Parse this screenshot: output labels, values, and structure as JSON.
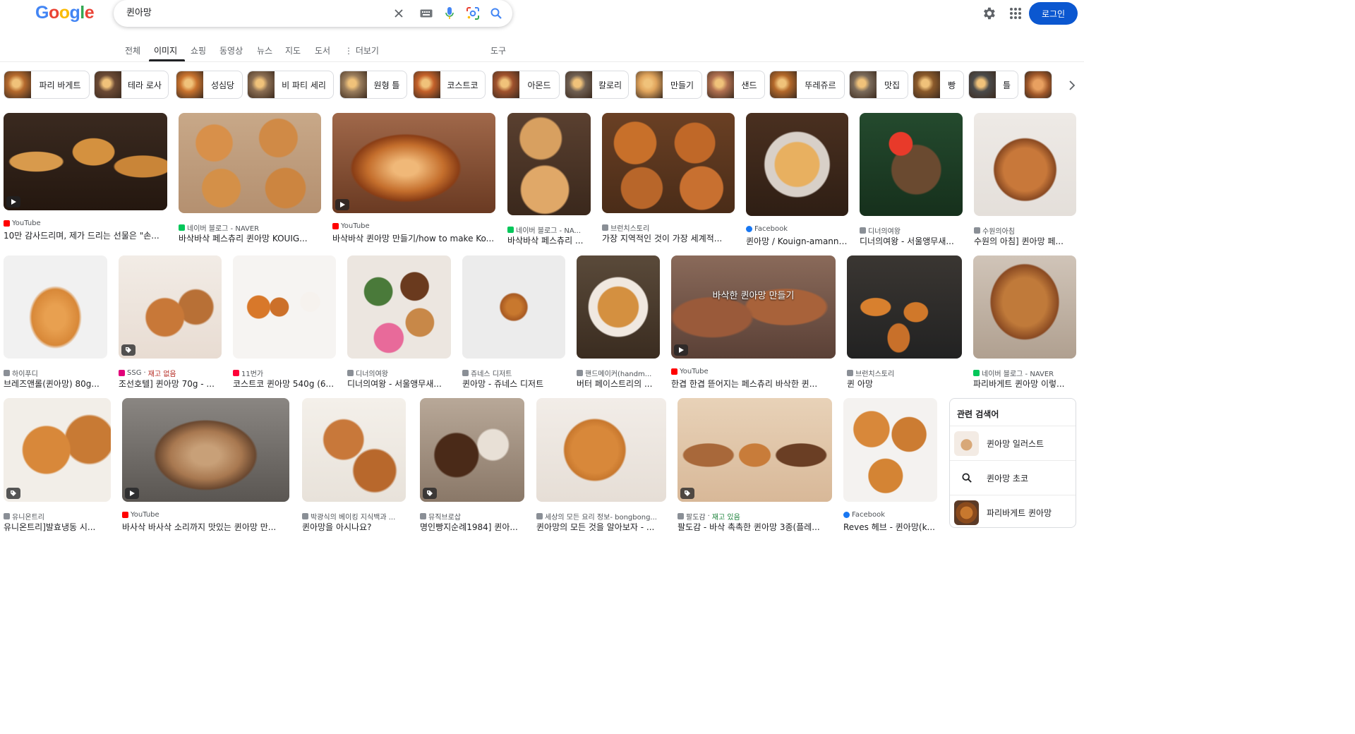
{
  "header": {
    "logo_letters": [
      {
        "ch": "G",
        "color": "#4285f4"
      },
      {
        "ch": "o",
        "color": "#ea4335"
      },
      {
        "ch": "o",
        "color": "#fbbc05"
      },
      {
        "ch": "g",
        "color": "#4285f4"
      },
      {
        "ch": "l",
        "color": "#34a853"
      },
      {
        "ch": "e",
        "color": "#ea4335"
      }
    ],
    "search_value": "퀸아망",
    "login_label": "로그인",
    "accent_color": "#0b57d0"
  },
  "tabs": {
    "all": "전체",
    "images": "이미지",
    "shopping": "쇼핑",
    "videos": "동영상",
    "news": "뉴스",
    "maps": "지도",
    "books": "도서",
    "more": "⋮ 더보기",
    "tools": "도구"
  },
  "chips": [
    "파리 바게트",
    "테라 로사",
    "성심당",
    "비 파티 세리",
    "원형 틀",
    "코스트코",
    "아몬드",
    "칼로리",
    "만들기",
    "샌드",
    "뚜레쥬르",
    "맛집",
    "빵",
    "틀"
  ],
  "results": [
    {
      "source": "YouTube",
      "title": "10만 감사드리며, 제가 드리는 선물은 \"손...",
      "video": true
    },
    {
      "source": "네이버 블로그 - NAVER",
      "title": "바삭바삭 페스츄리 퀸아망 KOUIG..."
    },
    {
      "source": "YouTube",
      "title": "바삭바삭 퀸아망 만들기/how to make Ko...",
      "video": true
    },
    {
      "source": "네이버 블로그 - NA...",
      "title": "바삭바삭 페스츄리 ..."
    },
    {
      "source": "브런치스토리",
      "title": "가장 지역적인 것이 가장 세계적..."
    },
    {
      "source": "Facebook",
      "title": "퀸아망 / Kouign-amann ..."
    },
    {
      "source": "디너의여왕",
      "title": "디너의여왕 - 서울앵무새..."
    },
    {
      "source": "수원의아침",
      "title": "수원의 아침] 퀸아망 페..."
    },
    {
      "source": "하이푸디",
      "title": "브레즈앤롤(퀸아망) 80g..."
    },
    {
      "source": "SSG",
      "stock": "재고 없음",
      "title": "조선호텔] 퀸아망 70g - ...",
      "tag": true
    },
    {
      "source": "11번가",
      "title": "코스트코 퀸아망 540g (6..."
    },
    {
      "source": "디너의여왕",
      "title": "디너의여왕 - 서울앵무새..."
    },
    {
      "source": "쥬네스 디저트",
      "title": "퀸아망 - 쥬네스 디저트"
    },
    {
      "source": "핸드메이커(handm...",
      "title": "버터 페이스트리의 ..."
    },
    {
      "source": "YouTube",
      "title": "한겹 한겹 뜯어지는 페스츄리 바삭한 퀸...",
      "video": true,
      "overlay": "바삭한 퀸아망 만들기"
    },
    {
      "source": "브런치스토리",
      "title": "퀸 아망"
    },
    {
      "source": "네이버 블로그 - NAVER",
      "title": "파리바게트 퀸아망 이렇..."
    },
    {
      "source": "유니온트리",
      "title": "유니온트리]발효냉동 시...",
      "tag": true
    },
    {
      "source": "YouTube",
      "title": "바사삭 바사삭 소리까지 맛있는 퀸아망 만...",
      "video": true
    },
    {
      "source": "박광식의 베이킹 지식백과 ...",
      "title": "퀸아망을 아시나요?"
    },
    {
      "source": "뮤직브로삽",
      "title": "명인빵지순례1984] 퀸아...",
      "tag": true
    },
    {
      "source": "세상의 모든 요리 정보- bongbong...",
      "title": "퀸아망의 모든 것을 알아보자 - ..."
    },
    {
      "source": "팔도감",
      "stock": "재고 있음",
      "title": "팔도감 - 바삭 촉촉한 퀸아망 3종(플레...",
      "tag": true
    },
    {
      "source": "Facebook",
      "title": "Reves 헤브 - 퀸아망(k..."
    }
  ],
  "related": {
    "heading": "관련 검색어",
    "items": [
      "퀸아망 일러스트",
      "퀸아망 초코",
      "파리바게트 퀸아망"
    ]
  }
}
